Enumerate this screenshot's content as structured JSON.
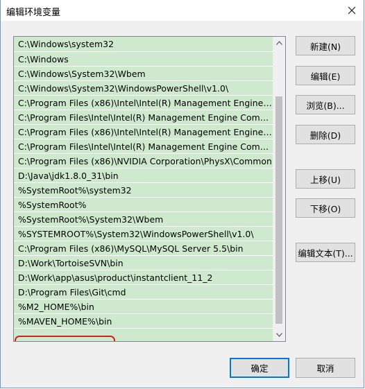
{
  "window": {
    "title": "编辑环境变量"
  },
  "paths": [
    "C:\\Windows\\system32",
    "C:\\Windows",
    "C:\\Windows\\System32\\Wbem",
    "C:\\Windows\\System32\\WindowsPowerShell\\v1.0\\",
    "C:\\Program Files (x86)\\Intel\\Intel(R) Management Engine Co...",
    "C:\\Program Files\\Intel\\Intel(R) Management Engine Compon...",
    "C:\\Program Files (x86)\\Intel\\Intel(R) Management Engine Co...",
    "C:\\Program Files\\Intel\\Intel(R) Management Engine Compon...",
    "C:\\Program Files (x86)\\NVIDIA Corporation\\PhysX\\Common",
    "D:\\Java\\jdk1.8.0_31\\bin",
    "%SystemRoot%\\system32",
    "%SystemRoot%",
    "%SystemRoot%\\System32\\Wbem",
    "%SYSTEMROOT%\\System32\\WindowsPowerShell\\v1.0\\",
    "C:\\Program Files (x86)\\MySQL\\MySQL Server 5.5\\bin",
    "D:\\Work\\TortoiseSVN\\bin",
    "D:\\Work\\app\\asus\\product\\instantclient_11_2",
    "D:\\Program Files\\Git\\cmd",
    "%M2_HOME%\\bin",
    "%MAVEN_HOME%\\bin"
  ],
  "buttons": {
    "new": "新建(N)",
    "edit": "编辑(E)",
    "browse": "浏览(B)...",
    "delete": "删除(D)",
    "move_up": "上移(U)",
    "move_down": "下移(O)",
    "edit_text": "编辑文本(T)...",
    "ok": "确定",
    "cancel": "取消"
  },
  "colors": {
    "list_bg": "#cfe9cf",
    "highlight": "#d22020",
    "accent": "#0078d7"
  }
}
